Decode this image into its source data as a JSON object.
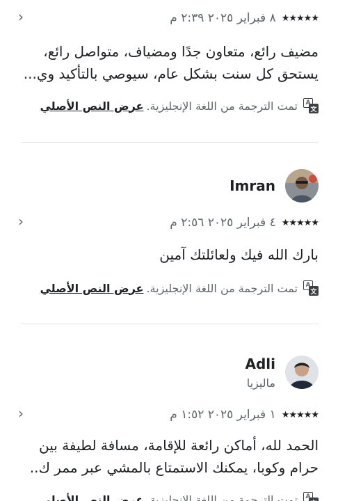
{
  "reviews": [
    {
      "stars": "★★★★★",
      "date": "٨ فبراير ٢٠٢٥ ٢:٣٩ م",
      "text": "مضيف رائع، متعاون جدًا ومضياف، متواصل رائع، يستحق كل سنت بشكل عام، سيوصي بالتأكيد وي...",
      "translation_note": "تمت الترجمة من اللغة الإنجليزية.",
      "show_original": "عرض النص الأصلي"
    },
    {
      "user_name": "Imran",
      "stars": "★★★★★",
      "date": "٤ فبراير ٢٠٢٥ ٢:٥٦ م",
      "text": "بارك الله فيك ولعائلتك آمين",
      "translation_note": "تمت الترجمة من اللغة الإنجليزية.",
      "show_original": "عرض النص الأصلي"
    },
    {
      "user_name": "Adli",
      "user_location": "ماليزيا",
      "stars": "★★★★★",
      "date": "١ فبراير ٢٠٢٥ ١:٥٢ م",
      "text": "الحمد لله، أماكن رائعة للإقامة، مسافة لطيفة بين حرام وكوبا، يمكنك الاستمتاع بالمشي عبر ممر ك..",
      "translation_note": "تمت الترجمة من اللغة الإنجليزية.",
      "show_original": "عرض النص الأصلي"
    }
  ],
  "icons": {
    "chevron": "chevron-right-icon",
    "translate": "translate-icon"
  }
}
